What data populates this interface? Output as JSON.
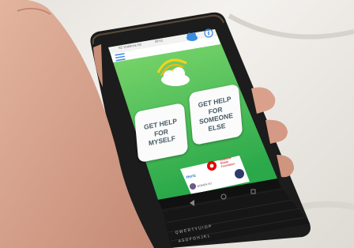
{
  "status_bar": {
    "carrier": "NZ Vodafone NZ",
    "time": "09:53"
  },
  "app": {
    "menu_icon": "hamburger-icon",
    "cloud_icon": "cloud-icon",
    "info_icon": "info-icon",
    "logo": "sun-cloud-logo"
  },
  "buttons": {
    "myself_lines": [
      "GET HELP",
      "FOR",
      "MYSELF"
    ],
    "someone_lines": [
      "GET HELP",
      "FOR",
      "SOMEONE",
      "ELSE"
    ]
  },
  "sponsors": {
    "vodafone_lines": [
      "Vodafone",
      "Mobile",
      "Foundation"
    ],
    "other_lines": [
      "Hertz",
      "BOWEN KO"
    ]
  },
  "colors": {
    "screen_top": "#7fd86a",
    "screen_bottom": "#2fae4c",
    "button_text": "#455a64"
  }
}
